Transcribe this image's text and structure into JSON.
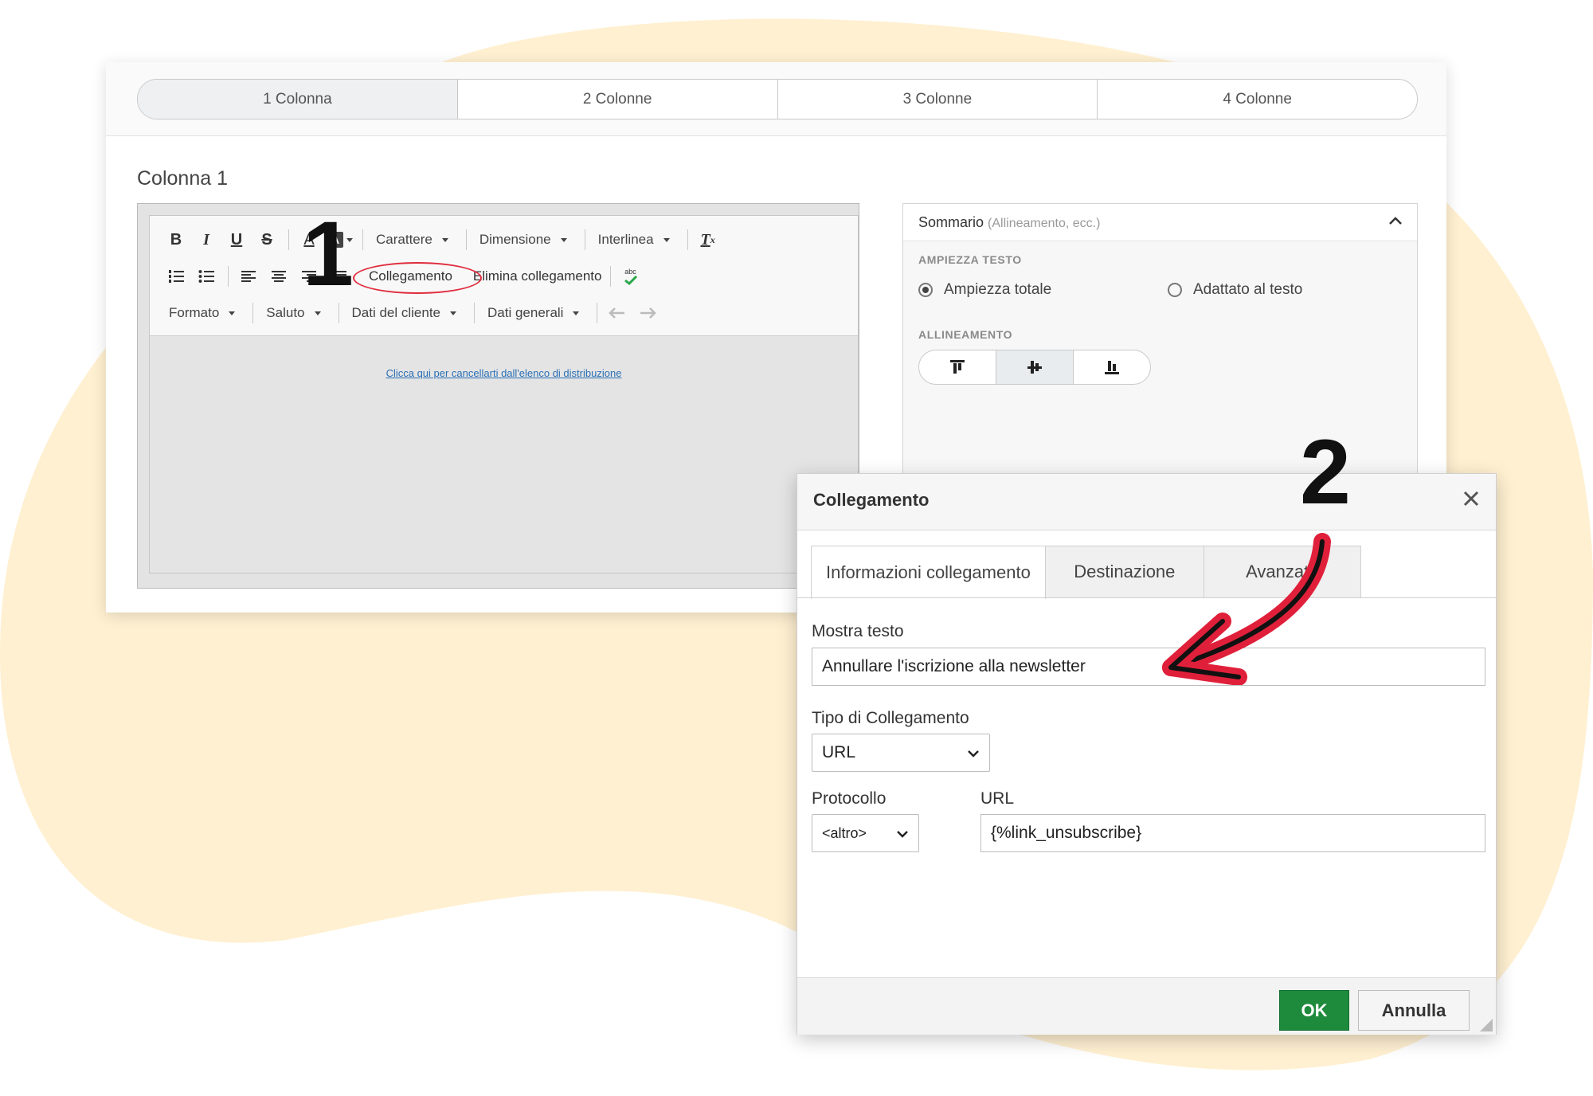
{
  "colors": {
    "blob": "#fff0d1",
    "ok_button": "#1e8a3c",
    "highlight_ring": "#e02b3c",
    "arrow": "#e0203a"
  },
  "layout_tabs": [
    "1 Colonna",
    "2 Colonne",
    "3 Colonne",
    "4 Colonne"
  ],
  "column_title": "Colonna 1",
  "toolbar": {
    "bold": "B",
    "italic": "I",
    "underline": "U",
    "strike": "S",
    "font_color": "A",
    "bg_color": "A",
    "font": "Carattere",
    "size": "Dimensione",
    "line_height": "Interlinea",
    "clear_format": "T",
    "link": "Collegamento",
    "unlink": "Elimina collegamento",
    "spellcheck": "abc",
    "format": "Formato",
    "greeting": "Saluto",
    "customer_data": "Dati del cliente",
    "general_data": "Dati generali"
  },
  "editor_link_text": "Clicca qui per cancellarti dall'elenco di distribuzione",
  "summary": {
    "title": "Sommario",
    "subtitle": "(Allineamento, ecc.)",
    "text_width_label": "AMPIEZZA TESTO",
    "option_full": "Ampiezza totale",
    "option_fit": "Adattato al testo",
    "alignment_label": "ALLINEAMENTO"
  },
  "annotations": {
    "step1": "1",
    "step2": "2"
  },
  "dialog": {
    "title": "Collegamento",
    "tabs": [
      "Informazioni collegamento",
      "Destinazione",
      "Avanzate"
    ],
    "display_text_label": "Mostra testo",
    "display_text_value": "Annullare l'iscrizione alla newsletter",
    "link_type_label": "Tipo di Collegamento",
    "link_type_value": "URL",
    "protocol_label": "Protocollo",
    "protocol_value": "<altro>",
    "url_label": "URL",
    "url_value": "{%link_unsubscribe}",
    "ok": "OK",
    "cancel": "Annulla"
  }
}
